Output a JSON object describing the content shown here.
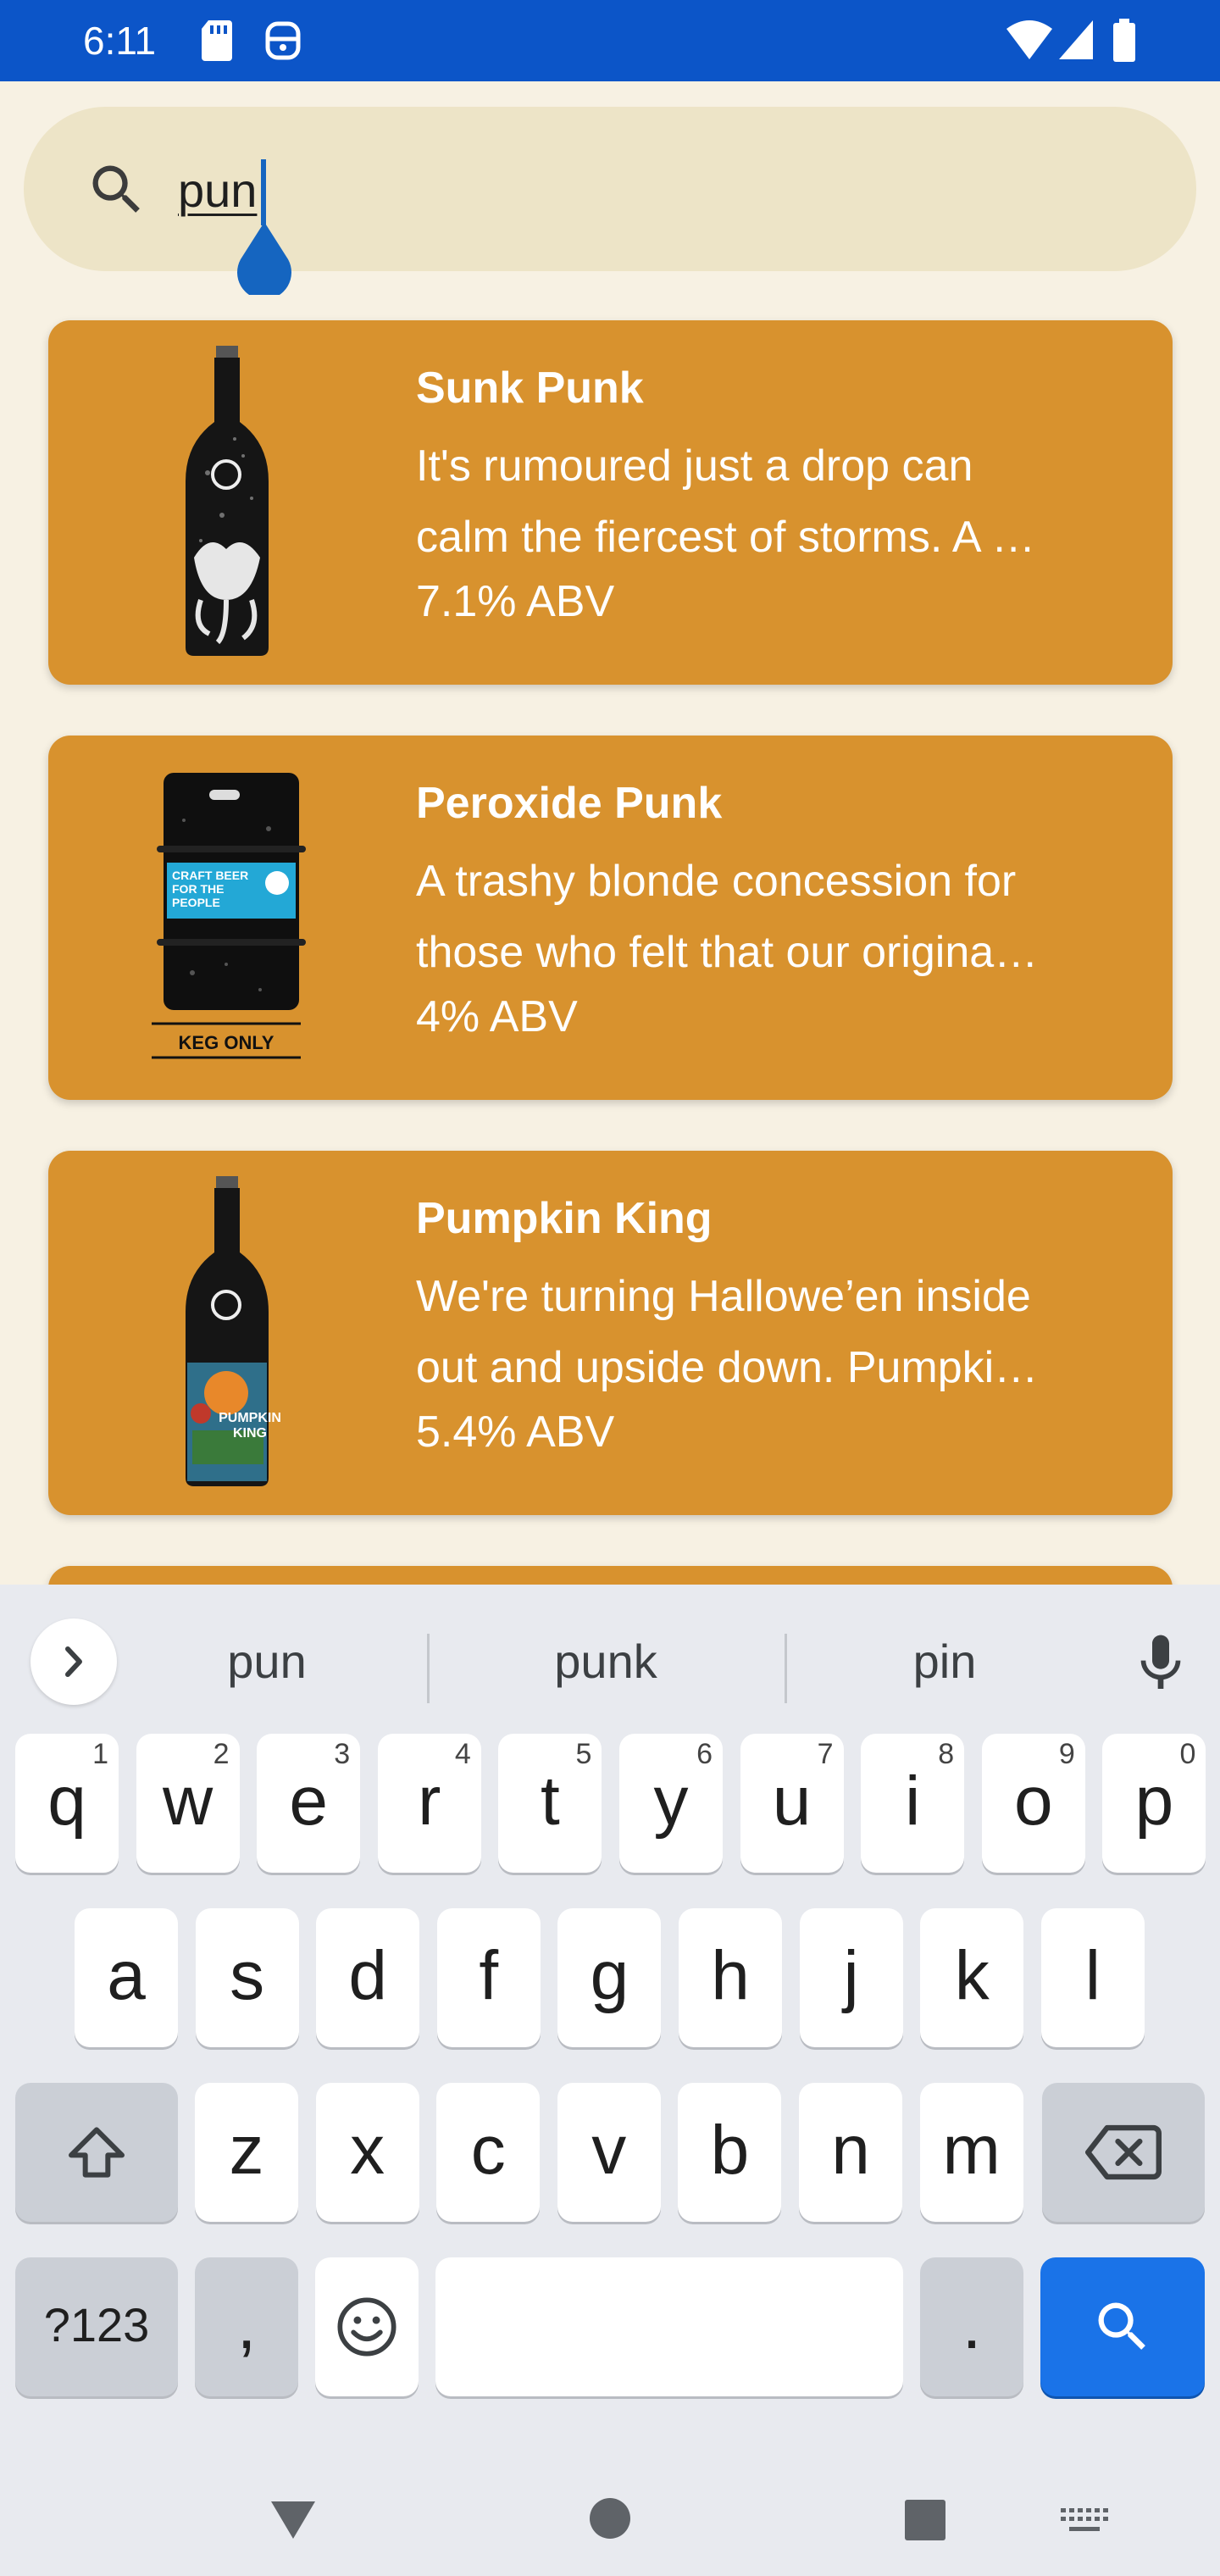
{
  "status_bar": {
    "time": "6:11",
    "icons": [
      "sd-card-icon",
      "assistant-icon",
      "wifi-icon",
      "signal-icon",
      "battery-icon"
    ]
  },
  "search": {
    "query": "pun",
    "icon": "search-icon"
  },
  "beers": [
    {
      "name": "Sunk Punk",
      "desc_line1": "It's rumoured just a drop can",
      "desc_line2": "calm the fiercest of storms. A …",
      "abv": "7.1% ABV",
      "image": "bottle-octopus"
    },
    {
      "name": "Peroxide Punk",
      "desc_line1": "A trashy blonde concession for",
      "desc_line2": "those who felt that our origina…",
      "abv": "4% ABV",
      "image": "keg-craft-beer",
      "keg_label": "KEG ONLY",
      "keg_sticker": "CRAFT BEER FOR THE PEOPLE"
    },
    {
      "name": "Pumpkin King",
      "desc_line1": "We're turning Hallowe’en inside",
      "desc_line2": "out and upside down. Pumpki…",
      "abv": "5.4% ABV",
      "image": "bottle-pumpkin",
      "bottle_label": "PUMPKIN KING"
    }
  ],
  "keyboard": {
    "suggestions": [
      "pun",
      "punk",
      "pin"
    ],
    "row1": [
      {
        "k": "q",
        "h": "1"
      },
      {
        "k": "w",
        "h": "2"
      },
      {
        "k": "e",
        "h": "3"
      },
      {
        "k": "r",
        "h": "4"
      },
      {
        "k": "t",
        "h": "5"
      },
      {
        "k": "y",
        "h": "6"
      },
      {
        "k": "u",
        "h": "7"
      },
      {
        "k": "i",
        "h": "8"
      },
      {
        "k": "o",
        "h": "9"
      },
      {
        "k": "p",
        "h": "0"
      }
    ],
    "row2": [
      "a",
      "s",
      "d",
      "f",
      "g",
      "h",
      "j",
      "k",
      "l"
    ],
    "row3": [
      "z",
      "x",
      "c",
      "v",
      "b",
      "n",
      "m"
    ],
    "symbols_label": "?123",
    "comma": ",",
    "period": "."
  },
  "colors": {
    "status_bar": "#0c55c8",
    "card": "#d8922e",
    "background": "#f7f1e3",
    "search_bg": "#ede4c7",
    "accent": "#1a73e8"
  }
}
